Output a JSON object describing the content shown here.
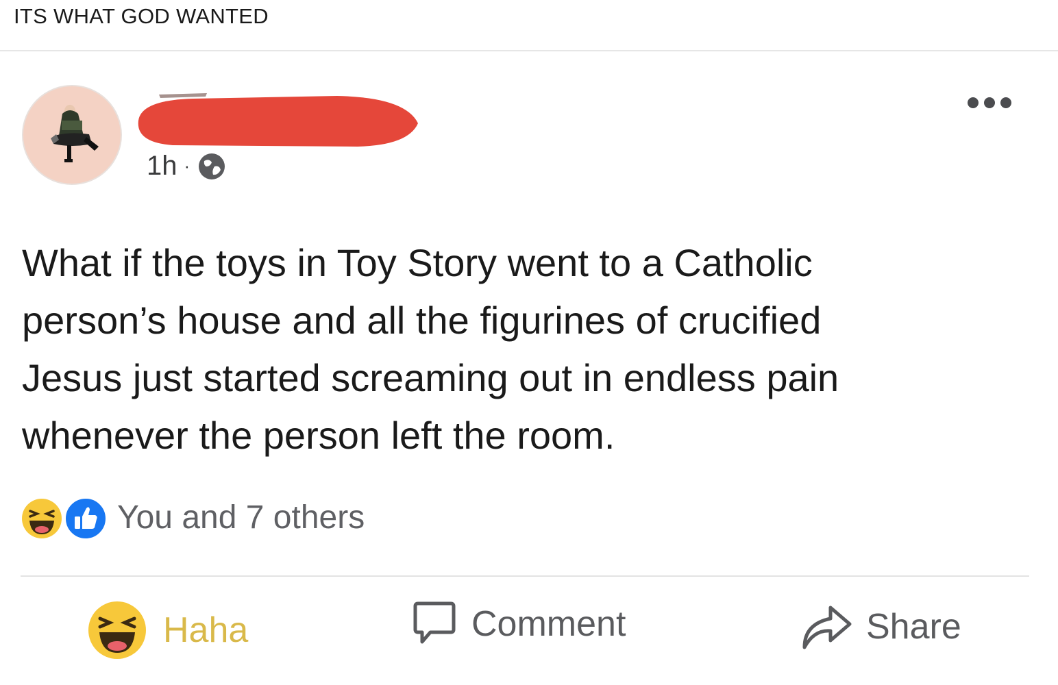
{
  "caption": "ITS WHAT GOD WANTED",
  "post": {
    "time": "1h",
    "separator": "·",
    "text_lines": [
      "What if the toys in Toy Story went to a Catholic",
      "person’s house and all the figurines of crucified",
      "Jesus just started screaming out in endless pain",
      "whenever the person left the room."
    ],
    "reactions_summary": "You and 7 others"
  },
  "actions": {
    "haha": "Haha",
    "comment": "Comment",
    "share": "Share"
  },
  "icons": {
    "avatar": "avatar-bernie-icon",
    "privacy": "globe-icon",
    "more": "more-dots-icon",
    "reaction1": "haha-icon",
    "reaction2": "like-icon",
    "comment": "comment-icon",
    "share": "share-icon"
  },
  "colors": {
    "redaction": "#e5473a",
    "like_blue": "#1877f2",
    "haha_yellow": "#f7c83a",
    "haha_label": "#d9b94a",
    "muted_text": "#5f6064"
  }
}
